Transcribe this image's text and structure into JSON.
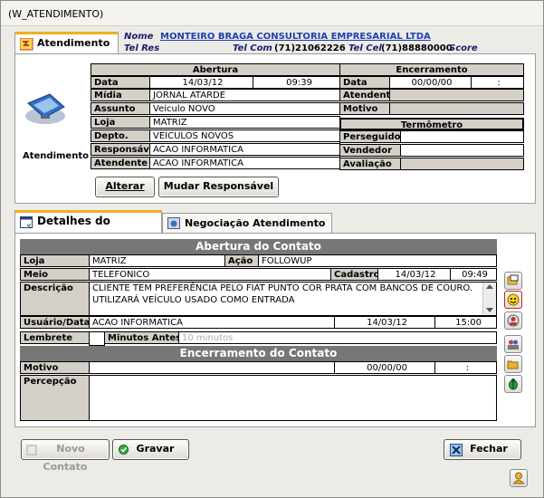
{
  "window": {
    "title": "(W_ATENDIMENTO)"
  },
  "tabs_top": {
    "atendimento": "Atendimento"
  },
  "header": {
    "nome_label": "Nome",
    "nome_value": "MONTEIRO BRAGA CONSULTORIA EMPRESARIAL LTDA",
    "telres_label": "Tel Res",
    "telcom_label": "Tel Com",
    "telcom_value": "(71)21062226",
    "telcel_label": "Tel Cel",
    "telcel_value": "(71)88880000",
    "score_label": "Score"
  },
  "side": {
    "caption": "Atendimento"
  },
  "abertura": {
    "title": "Abertura",
    "data_label": "Data",
    "data_date": "14/03/12",
    "data_time": "09:39",
    "midia_label": "Mídia",
    "midia_value": "JORNAL ATARDE",
    "assunto_label": "Assunto",
    "assunto_value": "Veiculo NOVO",
    "loja_label": "Loja",
    "loja_value": "MATRIZ",
    "depto_label": "Depto.",
    "depto_value": "VEICULOS NOVOS",
    "responsavel_label": "Responsável",
    "responsavel_value": "ACAO INFORMATICA",
    "atendente_label": "Atendente",
    "atendente_value": "ACAO INFORMATICA"
  },
  "encerramento": {
    "title": "Encerramento",
    "data_label": "Data",
    "data_date": "00/00/00",
    "data_time": ":",
    "atendente_label": "Atendente",
    "motivo_label": "Motivo"
  },
  "termometro": {
    "title": "Termômetro",
    "perseguidor_label": "Perseguidor",
    "vendedor_label": "Vendedor",
    "avaliacao_label": "Avaliação"
  },
  "buttons_top": {
    "alterar": "Alterar",
    "mudar": "Mudar Responsável"
  },
  "tabs_bottom": {
    "detalhes": "Detalhes do Contato",
    "negociacao": "Negociação Atendimento"
  },
  "contato": {
    "abertura_title": "Abertura do Contato",
    "loja_label": "Loja",
    "loja_value": "MATRIZ",
    "acao_label": "Ação",
    "acao_value": "FOLLOWUP",
    "meio_label": "Meio",
    "meio_value": "TELEFONICO",
    "cadastro_label": "Cadastro",
    "cadastro_date": "14/03/12",
    "cadastro_time": "09:49",
    "descricao_label": "Descrição",
    "descricao_value": "CLIENTE TEM PREFERÊNCIA PELO FIAT PUNTO COR PRATA COM BANCOS DE COURO. UTILIZARÁ VEÍCULO USADO COMO ENTRADA",
    "usuario_label": "Usuário/Data",
    "usuario_value": "ACAO INFORMATICA",
    "usuario_date": "14/03/12",
    "usuario_time": "15:00",
    "lembrete_label": "Lembrete",
    "minutos_label": "Minutos Antes",
    "minutos_placeholder": "10 minutos",
    "encerramento_title": "Encerramento do Contato",
    "motivo_label": "Motivo",
    "motivo_date": "00/00/00",
    "motivo_time": ":",
    "percepcao_label": "Percepção"
  },
  "buttons_bottom": {
    "novo": "Novo Contato",
    "gravar": "Gravar",
    "fechar": "Fechar"
  }
}
